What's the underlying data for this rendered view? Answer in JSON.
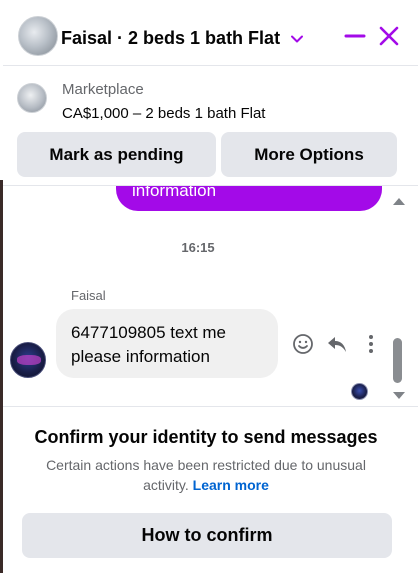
{
  "header": {
    "title": "Faisal · 2 beds 1 bath Flat",
    "accent_color": "#a30ae8"
  },
  "marketplace": {
    "source": "Marketplace",
    "listing": "CA$1,000 – 2 beds 1 bath Flat",
    "pending_label": "Mark as pending",
    "more_label": "More Options"
  },
  "chat": {
    "sent_partial": "information",
    "timestamp": "16:15",
    "sender_name": "Faisal",
    "received_text": "6477109805 text me please information",
    "bubble_color": "#a30ae8"
  },
  "restriction": {
    "title": "Confirm your identity to send messages",
    "description": "Certain actions have been restricted due to unusual activity.",
    "link": "Learn more",
    "button": "How to confirm"
  },
  "icons": [
    "chevron-down-icon",
    "minimize-icon",
    "close-icon",
    "emoji-icon",
    "reply-icon",
    "more-icon"
  ]
}
